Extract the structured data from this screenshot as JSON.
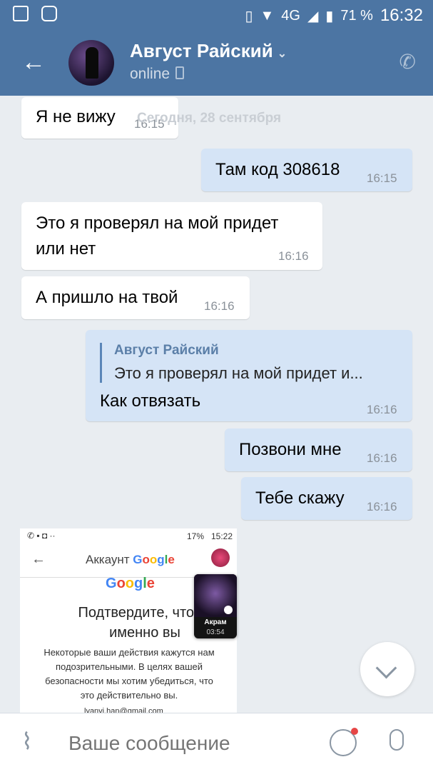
{
  "status_bar": {
    "battery": "71 %",
    "time": "16:32",
    "network": "4G"
  },
  "header": {
    "contact_name": "Август Райский",
    "status": "online"
  },
  "date_divider": "Сегодня, 28 сентября",
  "messages": [
    {
      "text": "Я не вижу",
      "time": "16:15",
      "direction": "in"
    },
    {
      "text": "Там код 308618",
      "time": "16:15",
      "direction": "out"
    },
    {
      "text_line1": "Это я проверял на мой придет",
      "text_line2": "или нет",
      "time": "16:16",
      "direction": "in"
    },
    {
      "text": "А пришло на твой",
      "time": "16:16",
      "direction": "in"
    },
    {
      "reply_to_name": "Август Райский",
      "reply_to_text": "Это я проверял на мой придет и...",
      "text": "Как отвязать",
      "time": "16:16",
      "direction": "out"
    },
    {
      "text": "Позвони мне",
      "time": "16:16",
      "direction": "out"
    },
    {
      "text": "Тебе скажу",
      "time": "16:16",
      "direction": "out"
    }
  ],
  "attachment": {
    "status_battery": "17%",
    "status_time": "15:22",
    "title_prefix": "Аккаунт",
    "google_letters": [
      "G",
      "o",
      "o",
      "g",
      "l",
      "e"
    ],
    "heading_line1": "Подтвердите, что эт",
    "heading_line2": "именно вы",
    "body_line1": "Некоторые ваши действия кажутся нам",
    "body_line2": "подозрительными. В целях вашей",
    "body_line3": "безопасности мы хотим убедиться, что",
    "body_line4": "это действительно вы.",
    "email": "lyanyi.han@gmail.com",
    "call_name": "Акрам",
    "call_duration": "03:54"
  },
  "composer": {
    "placeholder": "Ваше сообщение"
  }
}
